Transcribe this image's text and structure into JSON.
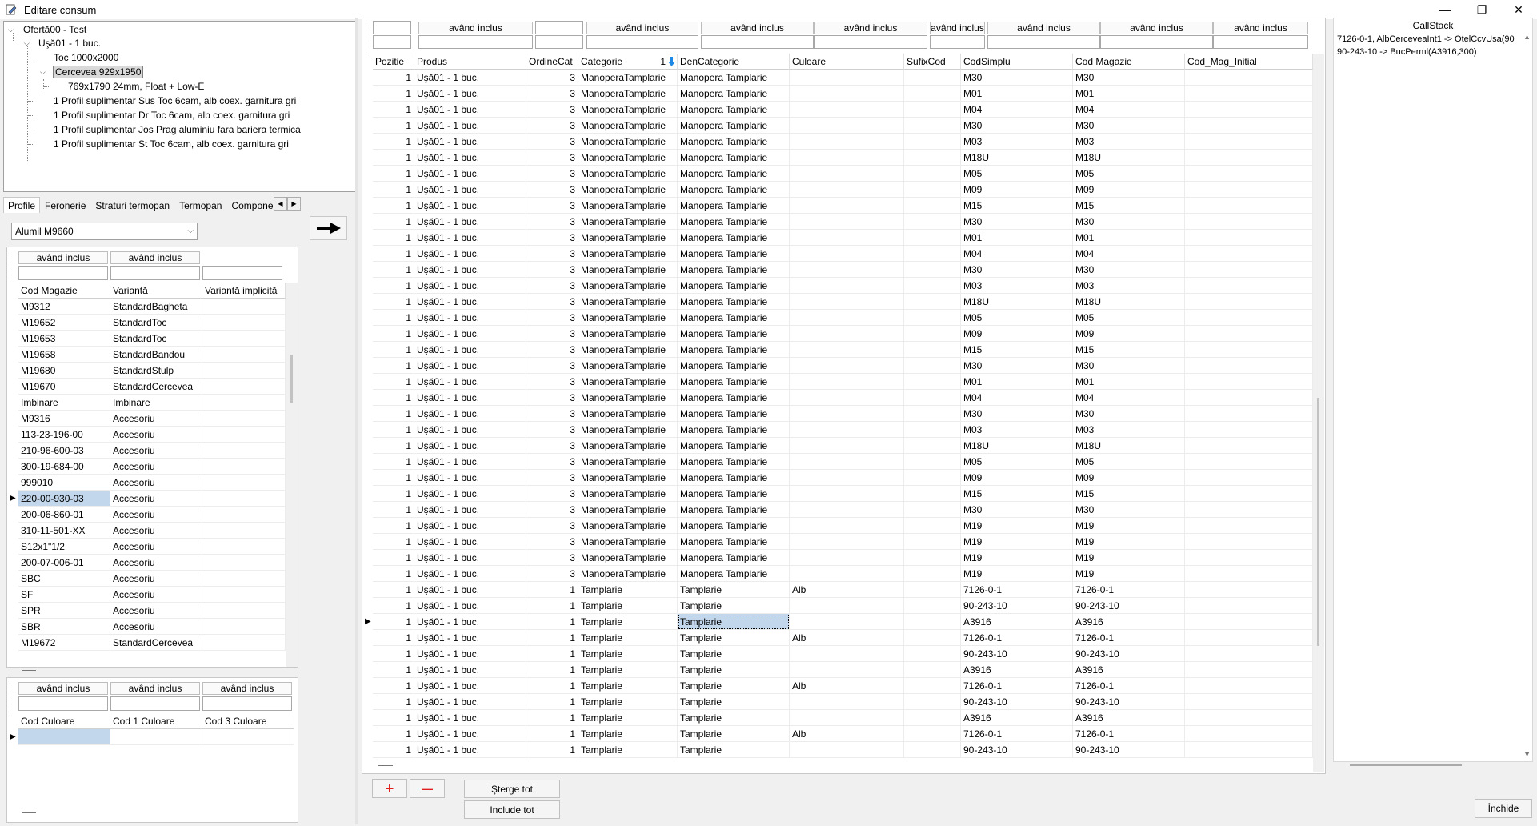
{
  "window": {
    "title": "Editare consum",
    "min": "—",
    "max": "❐",
    "close": "✕"
  },
  "tree": {
    "root": "Ofertă00 - Test",
    "child": "Uşă01 - 1 buc.",
    "toc": "Toc 1000x2000",
    "cercevea": "Cercevea 929x1950",
    "glass": "769x1790 24mm, Float + Low-E",
    "profiles": [
      "1 Profil suplimentar Sus  Toc 6cam, alb coex. garnitura gri",
      "1 Profil suplimentar Dr  Toc 6cam, alb coex. garnitura gri",
      "1 Profil suplimentar Jos  Prag aluminiu fara bariera termica",
      "1 Profil suplimentar St  Toc 6cam, alb coex. garnitura gri"
    ]
  },
  "tabs": [
    "Profile",
    "Feronerie",
    "Straturi termopan",
    "Termopan",
    "Compone"
  ],
  "combo": {
    "value": "Alumil M9660"
  },
  "filter_label": "având inclus",
  "profiles_grid": {
    "headers": [
      "Cod Magazie",
      "Variantă",
      "Variantă implicită"
    ],
    "rows": [
      [
        "M9312",
        "StandardBagheta"
      ],
      [
        "M19652",
        "StandardToc"
      ],
      [
        "M19653",
        "StandardToc"
      ],
      [
        "M19658",
        "StandardBandou"
      ],
      [
        "M19680",
        "StandardStulp"
      ],
      [
        "M19670",
        "StandardCercevea"
      ],
      [
        "Imbinare",
        "Imbinare"
      ],
      [
        "M9316",
        "Accesoriu"
      ],
      [
        "113-23-196-00",
        "Accesoriu"
      ],
      [
        "210-96-600-03",
        "Accesoriu"
      ],
      [
        "300-19-684-00",
        "Accesoriu"
      ],
      [
        "999010",
        "Accesoriu"
      ],
      [
        "220-00-930-03",
        "Accesoriu"
      ],
      [
        "200-06-860-01",
        "Accesoriu"
      ],
      [
        "310-11-501-XX",
        "Accesoriu"
      ],
      [
        "S12x1\"1/2",
        "Accesoriu"
      ],
      [
        "200-07-006-01",
        "Accesoriu"
      ],
      [
        "SBC",
        "Accesoriu"
      ],
      [
        "SF",
        "Accesoriu"
      ],
      [
        "SPR",
        "Accesoriu"
      ],
      [
        "SBR",
        "Accesoriu"
      ],
      [
        "M19672",
        "StandardCercevea"
      ]
    ],
    "selected_index": 12
  },
  "color_grid": {
    "headers": [
      "Cod Culoare",
      "Cod 1 Culoare",
      "Cod 3 Culoare"
    ]
  },
  "main_grid": {
    "headers": [
      "Pozitie",
      "Produs",
      "OrdineCat",
      "Categorie",
      "1",
      "DenCategorie",
      "Culoare",
      "SufixCod",
      "CodSimplu",
      "Cod Magazie",
      "Cod_Mag_Initial"
    ],
    "sort_icon": "arrow-down-icon",
    "rows": [
      [
        "1",
        "Uşă01 - 1 buc.",
        "3",
        "ManoperaTamplarie",
        "Manopera Tamplarie",
        "",
        "",
        "M30",
        "M30"
      ],
      [
        "1",
        "Uşă01 - 1 buc.",
        "3",
        "ManoperaTamplarie",
        "Manopera Tamplarie",
        "",
        "",
        "M01",
        "M01"
      ],
      [
        "1",
        "Uşă01 - 1 buc.",
        "3",
        "ManoperaTamplarie",
        "Manopera Tamplarie",
        "",
        "",
        "M04",
        "M04"
      ],
      [
        "1",
        "Uşă01 - 1 buc.",
        "3",
        "ManoperaTamplarie",
        "Manopera Tamplarie",
        "",
        "",
        "M30",
        "M30"
      ],
      [
        "1",
        "Uşă01 - 1 buc.",
        "3",
        "ManoperaTamplarie",
        "Manopera Tamplarie",
        "",
        "",
        "M03",
        "M03"
      ],
      [
        "1",
        "Uşă01 - 1 buc.",
        "3",
        "ManoperaTamplarie",
        "Manopera Tamplarie",
        "",
        "",
        "M18U",
        "M18U"
      ],
      [
        "1",
        "Uşă01 - 1 buc.",
        "3",
        "ManoperaTamplarie",
        "Manopera Tamplarie",
        "",
        "",
        "M05",
        "M05"
      ],
      [
        "1",
        "Uşă01 - 1 buc.",
        "3",
        "ManoperaTamplarie",
        "Manopera Tamplarie",
        "",
        "",
        "M09",
        "M09"
      ],
      [
        "1",
        "Uşă01 - 1 buc.",
        "3",
        "ManoperaTamplarie",
        "Manopera Tamplarie",
        "",
        "",
        "M15",
        "M15"
      ],
      [
        "1",
        "Uşă01 - 1 buc.",
        "3",
        "ManoperaTamplarie",
        "Manopera Tamplarie",
        "",
        "",
        "M30",
        "M30"
      ],
      [
        "1",
        "Uşă01 - 1 buc.",
        "3",
        "ManoperaTamplarie",
        "Manopera Tamplarie",
        "",
        "",
        "M01",
        "M01"
      ],
      [
        "1",
        "Uşă01 - 1 buc.",
        "3",
        "ManoperaTamplarie",
        "Manopera Tamplarie",
        "",
        "",
        "M04",
        "M04"
      ],
      [
        "1",
        "Uşă01 - 1 buc.",
        "3",
        "ManoperaTamplarie",
        "Manopera Tamplarie",
        "",
        "",
        "M30",
        "M30"
      ],
      [
        "1",
        "Uşă01 - 1 buc.",
        "3",
        "ManoperaTamplarie",
        "Manopera Tamplarie",
        "",
        "",
        "M03",
        "M03"
      ],
      [
        "1",
        "Uşă01 - 1 buc.",
        "3",
        "ManoperaTamplarie",
        "Manopera Tamplarie",
        "",
        "",
        "M18U",
        "M18U"
      ],
      [
        "1",
        "Uşă01 - 1 buc.",
        "3",
        "ManoperaTamplarie",
        "Manopera Tamplarie",
        "",
        "",
        "M05",
        "M05"
      ],
      [
        "1",
        "Uşă01 - 1 buc.",
        "3",
        "ManoperaTamplarie",
        "Manopera Tamplarie",
        "",
        "",
        "M09",
        "M09"
      ],
      [
        "1",
        "Uşă01 - 1 buc.",
        "3",
        "ManoperaTamplarie",
        "Manopera Tamplarie",
        "",
        "",
        "M15",
        "M15"
      ],
      [
        "1",
        "Uşă01 - 1 buc.",
        "3",
        "ManoperaTamplarie",
        "Manopera Tamplarie",
        "",
        "",
        "M30",
        "M30"
      ],
      [
        "1",
        "Uşă01 - 1 buc.",
        "3",
        "ManoperaTamplarie",
        "Manopera Tamplarie",
        "",
        "",
        "M01",
        "M01"
      ],
      [
        "1",
        "Uşă01 - 1 buc.",
        "3",
        "ManoperaTamplarie",
        "Manopera Tamplarie",
        "",
        "",
        "M04",
        "M04"
      ],
      [
        "1",
        "Uşă01 - 1 buc.",
        "3",
        "ManoperaTamplarie",
        "Manopera Tamplarie",
        "",
        "",
        "M30",
        "M30"
      ],
      [
        "1",
        "Uşă01 - 1 buc.",
        "3",
        "ManoperaTamplarie",
        "Manopera Tamplarie",
        "",
        "",
        "M03",
        "M03"
      ],
      [
        "1",
        "Uşă01 - 1 buc.",
        "3",
        "ManoperaTamplarie",
        "Manopera Tamplarie",
        "",
        "",
        "M18U",
        "M18U"
      ],
      [
        "1",
        "Uşă01 - 1 buc.",
        "3",
        "ManoperaTamplarie",
        "Manopera Tamplarie",
        "",
        "",
        "M05",
        "M05"
      ],
      [
        "1",
        "Uşă01 - 1 buc.",
        "3",
        "ManoperaTamplarie",
        "Manopera Tamplarie",
        "",
        "",
        "M09",
        "M09"
      ],
      [
        "1",
        "Uşă01 - 1 buc.",
        "3",
        "ManoperaTamplarie",
        "Manopera Tamplarie",
        "",
        "",
        "M15",
        "M15"
      ],
      [
        "1",
        "Uşă01 - 1 buc.",
        "3",
        "ManoperaTamplarie",
        "Manopera Tamplarie",
        "",
        "",
        "M30",
        "M30"
      ],
      [
        "1",
        "Uşă01 - 1 buc.",
        "3",
        "ManoperaTamplarie",
        "Manopera Tamplarie",
        "",
        "",
        "M19",
        "M19"
      ],
      [
        "1",
        "Uşă01 - 1 buc.",
        "3",
        "ManoperaTamplarie",
        "Manopera Tamplarie",
        "",
        "",
        "M19",
        "M19"
      ],
      [
        "1",
        "Uşă01 - 1 buc.",
        "3",
        "ManoperaTamplarie",
        "Manopera Tamplarie",
        "",
        "",
        "M19",
        "M19"
      ],
      [
        "1",
        "Uşă01 - 1 buc.",
        "3",
        "ManoperaTamplarie",
        "Manopera Tamplarie",
        "",
        "",
        "M19",
        "M19"
      ],
      [
        "1",
        "Uşă01 - 1 buc.",
        "1",
        "Tamplarie",
        "Tamplarie",
        "Alb",
        "",
        "7126-0-1",
        "7126-0-1"
      ],
      [
        "1",
        "Uşă01 - 1 buc.",
        "1",
        "Tamplarie",
        "Tamplarie",
        "",
        "",
        "90-243-10",
        "90-243-10"
      ],
      [
        "1",
        "Uşă01 - 1 buc.",
        "1",
        "Tamplarie",
        "Tamplarie",
        "",
        "",
        "A3916",
        "A3916"
      ],
      [
        "1",
        "Uşă01 - 1 buc.",
        "1",
        "Tamplarie",
        "Tamplarie",
        "Alb",
        "",
        "7126-0-1",
        "7126-0-1"
      ],
      [
        "1",
        "Uşă01 - 1 buc.",
        "1",
        "Tamplarie",
        "Tamplarie",
        "",
        "",
        "90-243-10",
        "90-243-10"
      ],
      [
        "1",
        "Uşă01 - 1 buc.",
        "1",
        "Tamplarie",
        "Tamplarie",
        "",
        "",
        "A3916",
        "A3916"
      ],
      [
        "1",
        "Uşă01 - 1 buc.",
        "1",
        "Tamplarie",
        "Tamplarie",
        "Alb",
        "",
        "7126-0-1",
        "7126-0-1"
      ],
      [
        "1",
        "Uşă01 - 1 buc.",
        "1",
        "Tamplarie",
        "Tamplarie",
        "",
        "",
        "90-243-10",
        "90-243-10"
      ],
      [
        "1",
        "Uşă01 - 1 buc.",
        "1",
        "Tamplarie",
        "Tamplarie",
        "",
        "",
        "A3916",
        "A3916"
      ],
      [
        "1",
        "Uşă01 - 1 buc.",
        "1",
        "Tamplarie",
        "Tamplarie",
        "Alb",
        "",
        "7126-0-1",
        "7126-0-1"
      ],
      [
        "1",
        "Uşă01 - 1 buc.",
        "1",
        "Tamplarie",
        "Tamplarie",
        "",
        "",
        "90-243-10",
        "90-243-10"
      ]
    ],
    "selected_index": 34
  },
  "buttons": {
    "add": "+",
    "remove": "—",
    "delete_all": "Şterge tot",
    "include_all": "Include tot",
    "close": "Închide"
  },
  "callstack": {
    "title": "CallStack",
    "lines": [
      "7126-0-1, AlbCerceveaInt1 -> OtelCcvUsa(90",
      "90-243-10 -> BucPerml(A3916,300)"
    ]
  },
  "colors": {
    "selection": "#c3d7ec",
    "red": "#e02020"
  }
}
